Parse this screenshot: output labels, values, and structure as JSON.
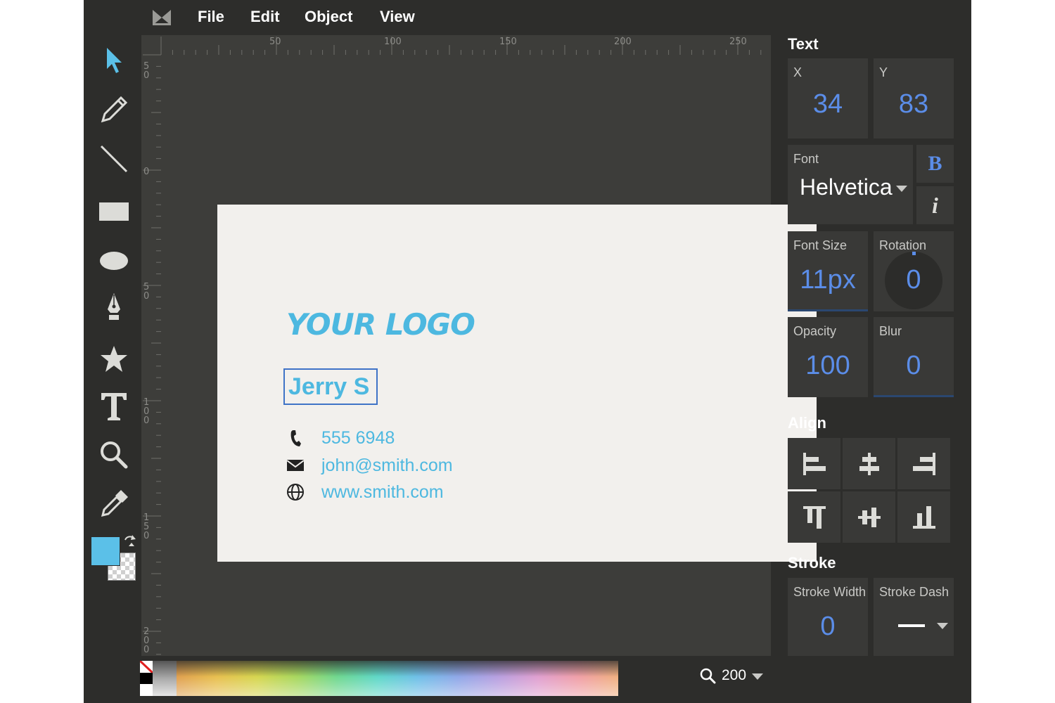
{
  "menu": {
    "items": [
      "File",
      "Edit",
      "Object",
      "View"
    ]
  },
  "toolbar": {
    "tools": [
      "select-icon",
      "pencil-icon",
      "line-icon",
      "rectangle-icon",
      "ellipse-icon",
      "pen-icon",
      "star-icon",
      "text-icon",
      "zoom-icon",
      "eyedropper-icon"
    ],
    "fill_color": "#5bc0e8",
    "stroke_color": "none"
  },
  "rulers": {
    "top_labels": [
      "50",
      "100",
      "150",
      "200",
      "250"
    ],
    "left_labels": [
      "5\n0",
      "0",
      "5\n0",
      "1\n0\n0",
      "1\n5\n0",
      "2\n0\n0"
    ]
  },
  "card": {
    "logo_text": "YOUR LOGO",
    "name": "Jerry S",
    "phone": "555 6948",
    "email": "john@smith.com",
    "website": "www.smith.com"
  },
  "text_panel": {
    "title": "Text",
    "x_label": "X",
    "x_value": "34",
    "y_label": "Y",
    "y_value": "83",
    "font_label": "Font",
    "font_value": "Helvetica",
    "bold_label": "B",
    "italic_label": "i",
    "font_size_label": "Font Size",
    "font_size_value": "11px",
    "rotation_label": "Rotation",
    "rotation_value": "0",
    "opacity_label": "Opacity",
    "opacity_value": "100",
    "blur_label": "Blur",
    "blur_value": "0"
  },
  "align_panel": {
    "title": "Align",
    "buttons": [
      "align-left-icon",
      "align-center-icon",
      "align-right-icon",
      "align-top-icon",
      "align-middle-icon",
      "align-bottom-icon"
    ]
  },
  "stroke_panel": {
    "title": "Stroke",
    "width_label": "Stroke Width",
    "width_value": "0",
    "dash_label": "Stroke Dash"
  },
  "zoom": {
    "value": "200"
  },
  "colors": {
    "accent": "#5b8de8",
    "card_text": "#4db8e0",
    "selection_border": "#3f73c7"
  }
}
